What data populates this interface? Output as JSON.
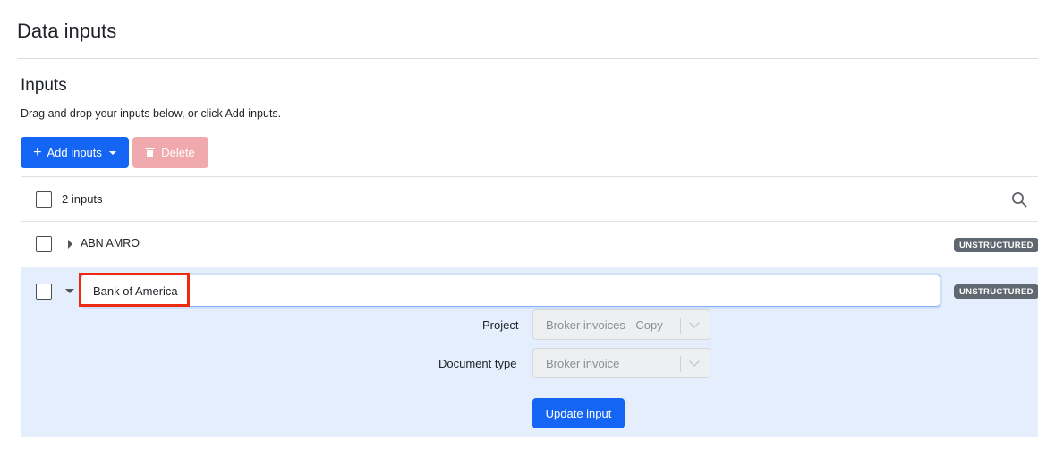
{
  "page": {
    "title": "Data inputs"
  },
  "inputs_section": {
    "title": "Inputs",
    "hint": "Drag and drop your inputs below, or click Add inputs."
  },
  "toolbar": {
    "add_label": "Add inputs",
    "delete_label": "Delete"
  },
  "list": {
    "count_label": "2 inputs",
    "rows": [
      {
        "name": "ABN AMRO",
        "badge": "UNSTRUCTURED",
        "expanded": false
      },
      {
        "name": "Bank of America",
        "badge": "UNSTRUCTURED",
        "expanded": true
      }
    ]
  },
  "editor": {
    "project_label": "Project",
    "project_value": "Broker invoices - Copy",
    "doctype_label": "Document type",
    "doctype_value": "Broker invoice",
    "update_label": "Update input"
  },
  "colors": {
    "primary": "#1565f5",
    "delete_disabled": "#f0a9ad",
    "selected_row": "#e4eefc",
    "badge": "#5f6770",
    "highlight": "#ee2a0f"
  }
}
